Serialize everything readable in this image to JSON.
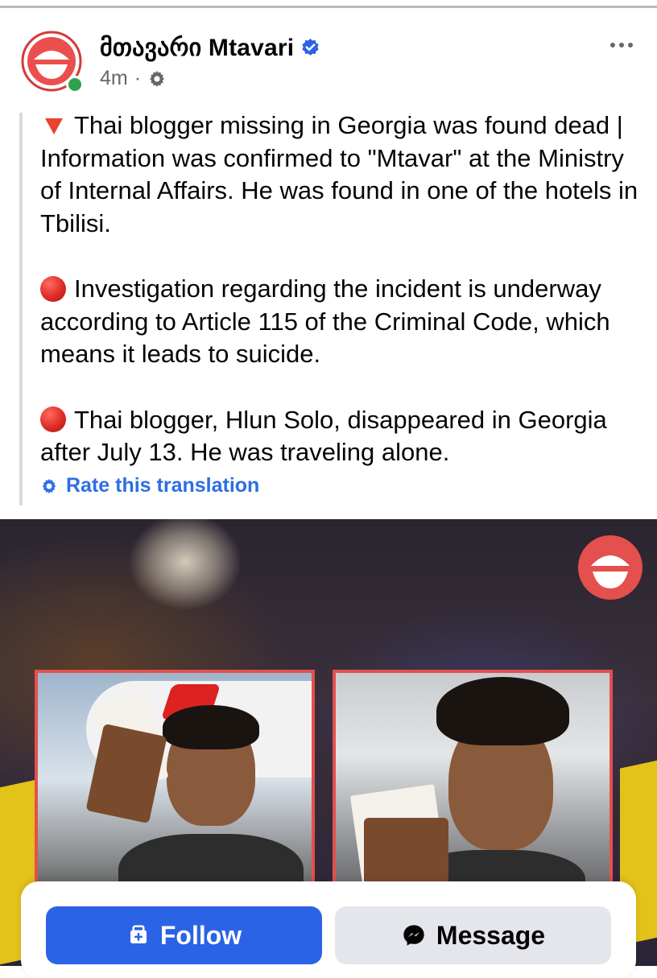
{
  "post": {
    "page_name": "მთავარი Mtavari",
    "time": "4m",
    "separator": "·",
    "paragraphs": [
      "Thai blogger missing in Georgia was found dead | Information was confirmed to \"Mtavar\" at the Ministry of Internal Affairs. He was found in one of the hotels in Tbilisi.",
      "Investigation regarding the incident is underway according to Article 115 of the Criminal Code, which means it leads to suicide.",
      "Thai blogger, Hlun Solo, disappeared in Georgia after July 13. He was traveling alone."
    ],
    "rate_translation": "Rate this translation"
  },
  "actions": {
    "follow_label": "Follow",
    "message_label": "Message"
  },
  "icons": {
    "verified": "verified-badge-icon",
    "audience": "gear-icon",
    "more": "more-dots-icon",
    "rate": "gear-icon",
    "follow": "follow-icon",
    "message": "messenger-icon"
  },
  "colors": {
    "accent_blue": "#2b63e6",
    "link_blue": "#2d6ee3",
    "brand_red": "#e4504d",
    "muted_text": "#65676b",
    "online_green": "#31a24c"
  }
}
